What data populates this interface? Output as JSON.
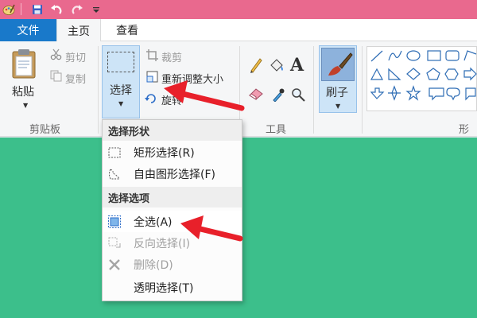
{
  "ribbon_tabs": {
    "file": "文件",
    "home": "主页",
    "view": "查看"
  },
  "clipboard": {
    "paste": "粘贴",
    "cut": "剪切",
    "copy": "复制",
    "group": "剪贴板"
  },
  "image": {
    "select": "选择",
    "crop": "裁剪",
    "resize": "重新调整大小",
    "rotate": "旋转"
  },
  "tools": {
    "group": "工具"
  },
  "brushes": {
    "label": "刷子"
  },
  "shapes": {
    "group": "形状"
  },
  "select_menu": {
    "shapes_header": "选择形状",
    "rect_select": "矩形选择(R)",
    "free_select": "自由图形选择(F)",
    "options_header": "选择选项",
    "select_all": "全选(A)",
    "invert": "反向选择(I)",
    "delete": "删除(D)",
    "transparent": "透明选择(T)"
  },
  "colors": {
    "titlebar": "#e9698e",
    "file_tab": "#1979ca",
    "canvas": "#3cbf8b",
    "arrow": "#e8202a"
  }
}
